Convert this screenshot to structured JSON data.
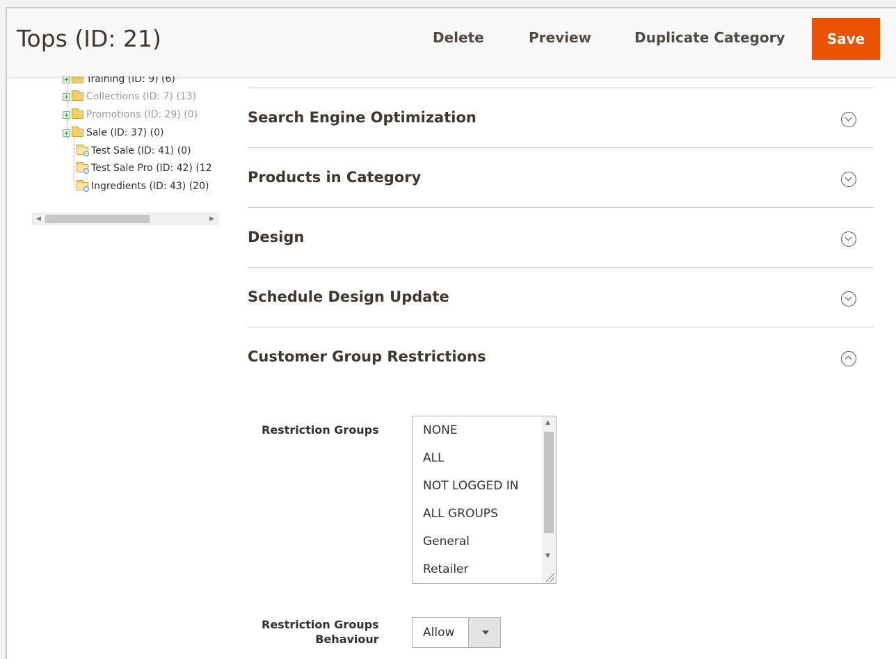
{
  "header": {
    "title": "Tops (ID: 21)",
    "actions": {
      "delete": "Delete",
      "preview": "Preview",
      "duplicate": "Duplicate Category",
      "save": "Save"
    },
    "save_color": "#eb5202"
  },
  "tree": {
    "items": [
      {
        "label": "Training (ID: 9) (6)",
        "expandable": true,
        "dimmed": false
      },
      {
        "label": "Collections (ID: 7) (13)",
        "expandable": true,
        "dimmed": true
      },
      {
        "label": "Promotions (ID: 29) (0)",
        "expandable": true,
        "dimmed": true
      },
      {
        "label": "Sale (ID: 37) (0)",
        "expandable": true,
        "dimmed": false
      },
      {
        "label": "Test Sale (ID: 41) (0)",
        "expandable": false,
        "dimmed": false
      },
      {
        "label": "Test Sale Pro (ID: 42) (12",
        "expandable": false,
        "dimmed": false
      },
      {
        "label": "Ingredients (ID: 43) (20)",
        "expandable": false,
        "dimmed": false
      }
    ]
  },
  "sections": [
    {
      "title": "Search Engine Optimization",
      "expanded": false
    },
    {
      "title": "Products in Category",
      "expanded": false
    },
    {
      "title": "Design",
      "expanded": false
    },
    {
      "title": "Schedule Design Update",
      "expanded": false
    },
    {
      "title": "Customer Group Restrictions",
      "expanded": true
    }
  ],
  "restrictions": {
    "groups_label": "Restriction Groups",
    "groups_options": [
      "NONE",
      "ALL",
      "NOT LOGGED IN",
      "ALL GROUPS",
      "General",
      "Retailer"
    ],
    "behaviour_label_line1": "Restriction Groups",
    "behaviour_label_line2": "Behaviour",
    "behaviour_value": "Allow"
  }
}
